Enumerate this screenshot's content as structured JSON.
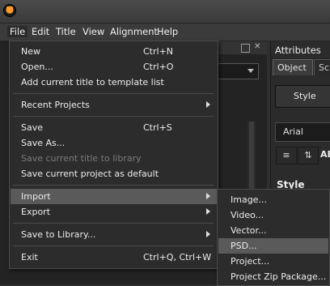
{
  "menubar": [
    "File",
    "Edit",
    "Title",
    "View",
    "Alignment",
    "Help"
  ],
  "file_menu": {
    "items": [
      {
        "label": "New",
        "shortcut": "Ctrl+N"
      },
      {
        "label": "Open...",
        "shortcut": "Ctrl+O"
      },
      {
        "label": "Add current title to template list",
        "shortcut": ""
      },
      {
        "label": "Recent Projects",
        "shortcut": "",
        "submenu": true
      },
      {
        "label": "Save",
        "shortcut": "Ctrl+S"
      },
      {
        "label": "Save As...",
        "shortcut": ""
      },
      {
        "label": "Save current title to library",
        "shortcut": "",
        "disabled": true
      },
      {
        "label": "Save current project as default",
        "shortcut": ""
      },
      {
        "label": "Import",
        "shortcut": "",
        "submenu": true,
        "highlighted": true
      },
      {
        "label": "Export",
        "shortcut": "",
        "submenu": true
      },
      {
        "label": "Save to Library...",
        "shortcut": "",
        "submenu": true
      },
      {
        "label": "Exit",
        "shortcut": "Ctrl+Q, Ctrl+W"
      }
    ]
  },
  "import_submenu": {
    "items": [
      "Image...",
      "Video...",
      "Vector...",
      "PSD...",
      "Project...",
      "Project Zip Package..."
    ],
    "highlighted": "PSD..."
  },
  "attributes_panel": {
    "title": "Attributes",
    "tabs": [
      "Object",
      "Sc"
    ],
    "style_button": "Style",
    "font": "Arial",
    "partial_label": "AB",
    "section": "Style Setti"
  },
  "colors": {
    "accent": "#ff9b2a",
    "menu_bg": "#2c2c2c",
    "highlight": "#5a5a5a"
  }
}
